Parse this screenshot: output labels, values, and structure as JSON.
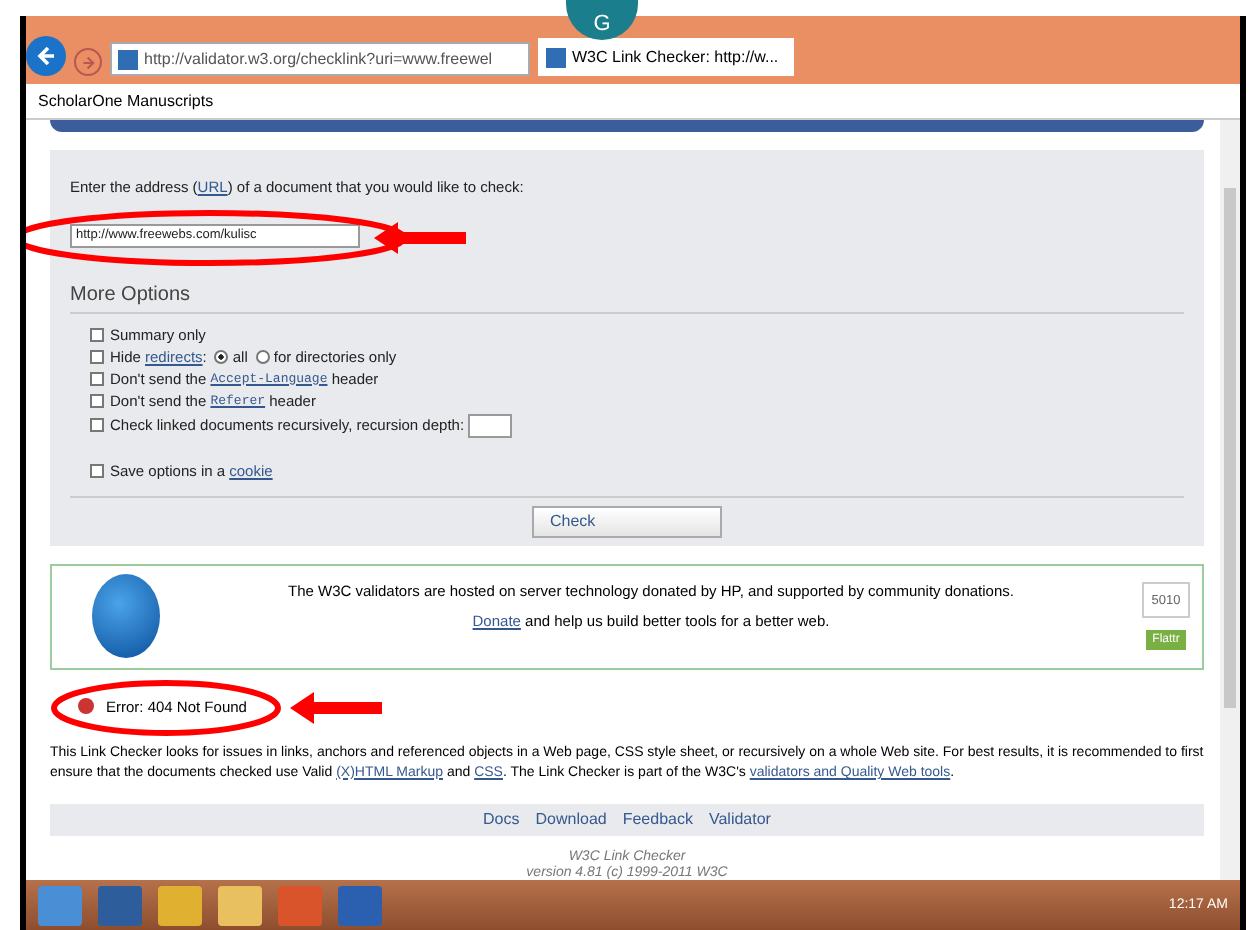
{
  "browser": {
    "url": "http://validator.w3.org/checklink?uri=www.freewel",
    "tab_title": "W3C Link Checker: http://w...",
    "badge_letter": "G",
    "bookmarks": [
      "ScholarOne Manuscripts"
    ]
  },
  "form": {
    "prompt": [
      {
        "kind": "text",
        "text": "Enter the address ("
      },
      {
        "kind": "link",
        "text": "URL"
      },
      {
        "kind": "text",
        "text": ") of a document that you would like to check:"
      }
    ],
    "url_value": "http://www.freewebs.com/kulisc",
    "url_annotations": [
      {
        "kind": "ellipse"
      },
      {
        "kind": "arrow"
      }
    ],
    "options_title": "More Options",
    "options": [
      {
        "checked": false,
        "parts": [
          {
            "kind": "text",
            "text": "Summary only"
          }
        ]
      },
      {
        "checked": false,
        "parts": [
          {
            "kind": "text",
            "text": "Hide "
          },
          {
            "kind": "link",
            "text": "redirects"
          },
          {
            "kind": "text",
            "text": ":"
          },
          {
            "kind": "radio",
            "selected": true,
            "text": "all"
          },
          {
            "kind": "radio",
            "selected": false,
            "text": "for directories only"
          }
        ]
      },
      {
        "checked": false,
        "parts": [
          {
            "kind": "text",
            "text": "Don't send the "
          },
          {
            "kind": "code",
            "text": "Accept-Language"
          },
          {
            "kind": "text",
            "text": " header"
          }
        ]
      },
      {
        "checked": false,
        "parts": [
          {
            "kind": "text",
            "text": "Don't send the "
          },
          {
            "kind": "code",
            "text": "Referer"
          },
          {
            "kind": "text",
            "text": " header"
          }
        ]
      },
      {
        "checked": false,
        "parts": [
          {
            "kind": "text",
            "text": "Check linked documents recursively, recursion depth:"
          },
          {
            "kind": "field"
          }
        ]
      }
    ],
    "save": {
      "checked": false,
      "parts": [
        {
          "kind": "text",
          "text": "Save options in a "
        },
        {
          "kind": "link",
          "text": "cookie"
        }
      ]
    },
    "submit": "Check"
  },
  "sponsor": {
    "line1": "The W3C validators are hosted on server technology donated by HP, and supported by community donations.",
    "donate_link": "Donate",
    "line2": " and help us build better tools for a better web.",
    "count": "5010",
    "flattr": "Flattr"
  },
  "error": "Error: 404 Not Found",
  "error_annotations": [
    {
      "kind": "ellipse"
    },
    {
      "kind": "arrow"
    }
  ],
  "description": [
    {
      "kind": "text",
      "text": "This Link Checker looks for issues in links, anchors and referenced objects in a Web page, CSS style sheet, or recursively on a whole Web site. For best results, it is recommended to first ensure that the documents checked use Valid "
    },
    {
      "kind": "link",
      "text": "(X)HTML Markup"
    },
    {
      "kind": "text",
      "text": " and "
    },
    {
      "kind": "link",
      "text": "CSS"
    },
    {
      "kind": "text",
      "text": ". The Link Checker is part of the W3C's "
    },
    {
      "kind": "link",
      "text": "validators and Quality Web tools"
    },
    {
      "kind": "text",
      "text": "."
    }
  ],
  "footer_links": [
    "Docs",
    "Download",
    "Feedback",
    "Validator"
  ],
  "footer_lines": [
    "W3C Link Checker",
    "version 4.81 (c) 1999-2011 W3C"
  ],
  "taskbar": {
    "time": "12:17 AM"
  }
}
